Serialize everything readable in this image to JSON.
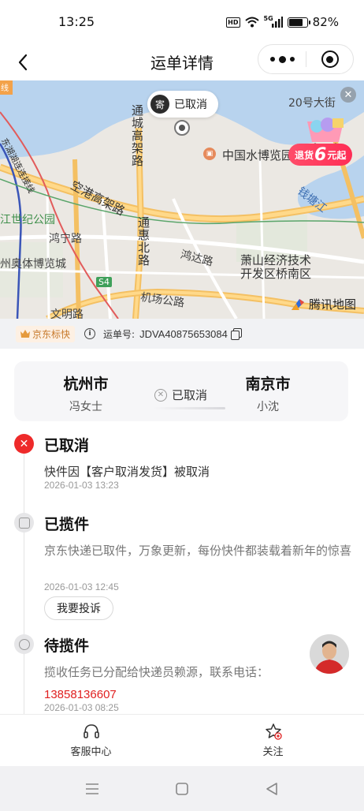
{
  "status_bar": {
    "time": "13:25",
    "hd": "HD",
    "signal": "5G",
    "battery": "82%",
    "battery_level": 0.82
  },
  "nav": {
    "title": "运单详情"
  },
  "map": {
    "status_pin": {
      "badge": "寄",
      "text": "已取消"
    },
    "labels": {
      "road_20": "20号大街",
      "tongcheng": "通城高架路",
      "museum": "中国水博览园",
      "konggang": "空港高架路",
      "qiantang": "钱塘江",
      "century_park": "江世纪公园",
      "hongning": "鸿宁路",
      "tonghui": "通惠北路",
      "hongda": "鸿达路",
      "xiaoshan_dev": "萧山经济技术开发区桥南区",
      "olympic": "州奥体博览城",
      "s4": "S4",
      "airport_rd": "机场公路",
      "wenming": "文明路",
      "top_left_chip": "线",
      "northeast": "东湖湖连连接线"
    },
    "promo": {
      "text_pre": "退货",
      "number": "6",
      "text_post": "元起"
    },
    "brand": "腾讯地图"
  },
  "info": {
    "brand_chip": "京东标快",
    "waybill_label": "运单号:",
    "waybill_number": "JDVA40875653084"
  },
  "route": {
    "from_city": "杭州市",
    "from_person": "冯女士",
    "status": "已取消",
    "to_city": "南京市",
    "to_person": "小沈"
  },
  "timeline": [
    {
      "title": "已取消",
      "desc": "快件因【客户取消发货】被取消",
      "time": "2026-01-03 13:23"
    },
    {
      "title": "已揽件",
      "desc": "京东快递已取件，万象更新，每份快件都装载着新年的惊喜",
      "time": "2026-01-03 12:45",
      "button": "我要投诉"
    },
    {
      "title": "待揽件",
      "desc": "揽收任务已分配给快递员赖源，联系电话：",
      "phone": "13858136607",
      "time": "2026-01-03 08:25"
    }
  ],
  "bottom": {
    "service": "客服中心",
    "follow": "关注"
  },
  "colors": {
    "accent_red": "#ee2a2a",
    "brand_orange": "#c77a2c",
    "water": "#b8d3ee"
  }
}
